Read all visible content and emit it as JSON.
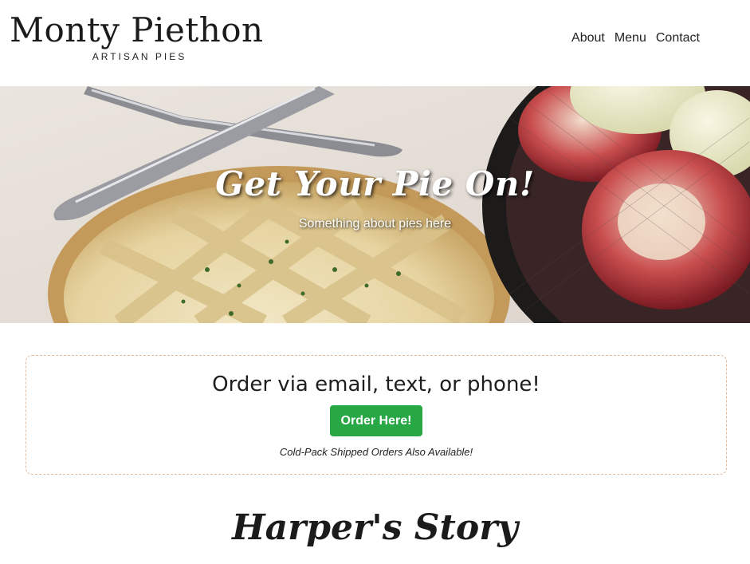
{
  "header": {
    "brand_name": "Monty Piethon",
    "brand_tagline": "ARTISAN PIES",
    "nav": [
      {
        "label": "About"
      },
      {
        "label": "Menu"
      },
      {
        "label": "Contact"
      }
    ]
  },
  "hero": {
    "title": "Get Your Pie On!",
    "subtitle": "Something about pies here",
    "image_icon": "pie-photo"
  },
  "order": {
    "heading": "Order via email, text, or phone!",
    "button_label": "Order Here!",
    "note": "Cold-Pack Shipped Orders Also Available!"
  },
  "story": {
    "heading": "Harper's Story"
  },
  "colors": {
    "accent_green": "#28a745",
    "box_border": "#e2b89a"
  }
}
